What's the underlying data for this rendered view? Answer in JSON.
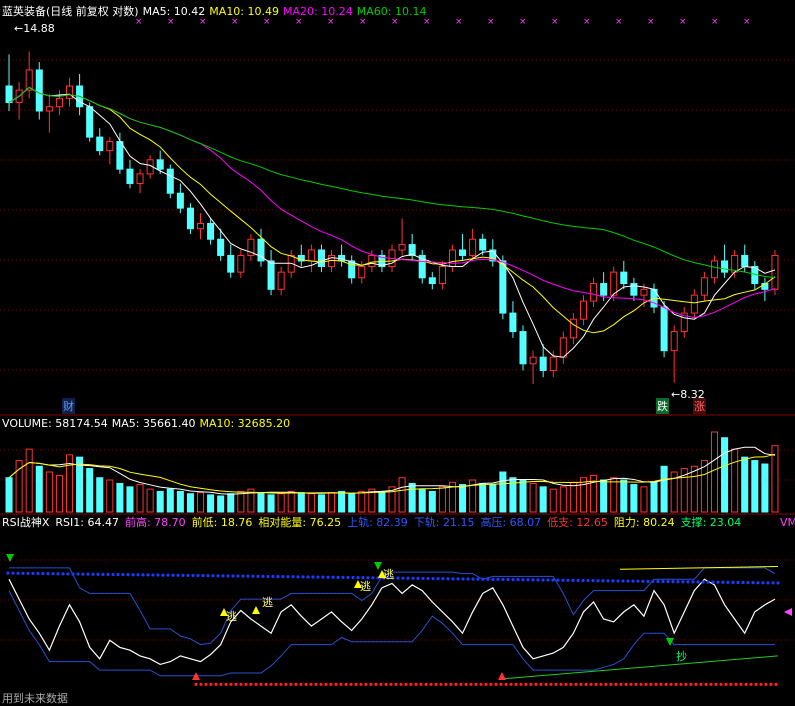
{
  "colors": {
    "bg": "#000000",
    "grid": "#6b0000",
    "up": "#ff3232",
    "down": "#54ffff",
    "ma5": "#ffffff",
    "ma10": "#ffff00",
    "ma20": "#ff00ff",
    "ma60": "#00cc00",
    "rsi": "#ffffff",
    "band": "#2a50d0",
    "blue_dots": "#1a3cff",
    "red_dots": "#ff2020",
    "yellow_line": "#ffff00",
    "green_line": "#22cc22"
  },
  "price_header": {
    "title": "蓝英装备(日线 前复权 对数)",
    "ma5": "MA5: 10.42",
    "ma10": "MA10: 10.49",
    "ma20": "MA20: 10.24",
    "ma60": "MA60: 10.14"
  },
  "price_annotations": {
    "high": "14.88",
    "low": "8.32",
    "cai": "财",
    "die": "跌",
    "zhang": "涨",
    "marks": [
      "×",
      "×",
      "×",
      "×",
      "×",
      "×",
      "×",
      "×",
      "×",
      "×",
      "×",
      "×",
      "×",
      "×",
      "×",
      "×",
      "×",
      "×",
      "×",
      "×"
    ]
  },
  "volume_header": {
    "volume": "VOLUME: 58174.54",
    "ma5": "MA5: 35661.40",
    "ma10": "MA10: 32685.20"
  },
  "rsi_header": {
    "name": "RSI战神X",
    "rsi1": "RSI1: 64.47",
    "qiangao": "前高: 78.70",
    "qiandi": "前低: 18.76",
    "xiangdui": "相对能量: 76.25",
    "shanggui": "上轨: 82.39",
    "xiagui": "下轨: 21.15",
    "gaoya": "高压: 68.07",
    "dizhi": "低支: 12.65",
    "zuli": "阻力: 80.24",
    "zhicheng": "支撑: 23.04",
    "more": "VM"
  },
  "rsi_annotations": {
    "tao": "逃",
    "chao": "抄",
    "footer": "用到未来数据"
  },
  "chart_data": {
    "type": "candlestick",
    "scale": "log",
    "ylim": [
      8.0,
      15.5
    ],
    "candles": [
      [
        14.0,
        14.8,
        13.4,
        13.6
      ],
      [
        13.6,
        14.1,
        13.2,
        13.9
      ],
      [
        13.9,
        14.88,
        13.7,
        14.4
      ],
      [
        14.4,
        14.6,
        13.2,
        13.4
      ],
      [
        13.4,
        13.8,
        12.9,
        13.5
      ],
      [
        13.5,
        13.9,
        13.3,
        13.7
      ],
      [
        13.7,
        14.2,
        13.5,
        14.0
      ],
      [
        14.0,
        14.3,
        13.3,
        13.5
      ],
      [
        13.5,
        13.6,
        12.7,
        12.8
      ],
      [
        12.8,
        13.0,
        12.4,
        12.5
      ],
      [
        12.5,
        12.8,
        12.2,
        12.7
      ],
      [
        12.7,
        12.9,
        12.0,
        12.1
      ],
      [
        12.1,
        12.3,
        11.7,
        11.8
      ],
      [
        11.8,
        12.1,
        11.6,
        12.0
      ],
      [
        12.0,
        12.4,
        11.9,
        12.3
      ],
      [
        12.3,
        12.5,
        12.0,
        12.1
      ],
      [
        12.1,
        12.2,
        11.5,
        11.6
      ],
      [
        11.6,
        11.8,
        11.2,
        11.3
      ],
      [
        11.3,
        11.4,
        10.8,
        10.9
      ],
      [
        10.9,
        11.2,
        10.7,
        11.0
      ],
      [
        11.0,
        11.1,
        10.6,
        10.7
      ],
      [
        10.7,
        10.9,
        10.3,
        10.4
      ],
      [
        10.4,
        10.6,
        10.0,
        10.1
      ],
      [
        10.1,
        10.5,
        10.0,
        10.4
      ],
      [
        10.4,
        10.8,
        10.3,
        10.7
      ],
      [
        10.7,
        10.9,
        10.2,
        10.3
      ],
      [
        10.3,
        10.5,
        9.7,
        9.8
      ],
      [
        9.8,
        10.2,
        9.7,
        10.1
      ],
      [
        10.1,
        10.5,
        10.0,
        10.4
      ],
      [
        10.4,
        10.6,
        10.2,
        10.3
      ],
      [
        10.3,
        10.6,
        10.1,
        10.5
      ],
      [
        10.5,
        10.6,
        10.1,
        10.2
      ],
      [
        10.2,
        10.5,
        10.1,
        10.4
      ],
      [
        10.4,
        10.6,
        10.2,
        10.3
      ],
      [
        10.3,
        10.4,
        9.9,
        10.0
      ],
      [
        10.0,
        10.3,
        9.9,
        10.2
      ],
      [
        10.2,
        10.5,
        10.1,
        10.4
      ],
      [
        10.4,
        10.5,
        10.1,
        10.2
      ],
      [
        10.2,
        10.6,
        10.1,
        10.5
      ],
      [
        10.5,
        11.1,
        10.4,
        10.6
      ],
      [
        10.6,
        10.8,
        10.3,
        10.4
      ],
      [
        10.4,
        10.5,
        9.9,
        10.0
      ],
      [
        10.0,
        10.1,
        9.8,
        9.9
      ],
      [
        9.9,
        10.3,
        9.8,
        10.2
      ],
      [
        10.2,
        10.6,
        10.1,
        10.5
      ],
      [
        10.5,
        10.8,
        10.3,
        10.4
      ],
      [
        10.4,
        10.9,
        10.3,
        10.7
      ],
      [
        10.7,
        10.8,
        10.4,
        10.5
      ],
      [
        10.5,
        10.7,
        10.2,
        10.3
      ],
      [
        10.3,
        10.4,
        9.3,
        9.4
      ],
      [
        9.4,
        9.6,
        9.0,
        9.1
      ],
      [
        9.1,
        9.2,
        8.5,
        8.6
      ],
      [
        8.6,
        8.8,
        8.3,
        8.7
      ],
      [
        8.7,
        8.9,
        8.4,
        8.5
      ],
      [
        8.5,
        8.8,
        8.4,
        8.7
      ],
      [
        8.7,
        9.1,
        8.6,
        9.0
      ],
      [
        9.0,
        9.4,
        8.9,
        9.3
      ],
      [
        9.3,
        9.7,
        9.2,
        9.6
      ],
      [
        9.6,
        10.0,
        9.5,
        9.9
      ],
      [
        9.9,
        10.1,
        9.6,
        9.7
      ],
      [
        9.7,
        10.2,
        9.6,
        10.1
      ],
      [
        10.1,
        10.3,
        9.8,
        9.9
      ],
      [
        9.9,
        10.0,
        9.6,
        9.7
      ],
      [
        9.7,
        9.9,
        9.5,
        9.8
      ],
      [
        9.8,
        9.9,
        9.4,
        9.5
      ],
      [
        9.5,
        9.6,
        8.7,
        8.8
      ],
      [
        8.8,
        9.2,
        8.32,
        9.1
      ],
      [
        9.1,
        9.5,
        9.0,
        9.4
      ],
      [
        9.4,
        9.8,
        9.3,
        9.7
      ],
      [
        9.7,
        10.1,
        9.6,
        10.0
      ],
      [
        10.0,
        10.4,
        9.9,
        10.3
      ],
      [
        10.3,
        10.6,
        10.0,
        10.1
      ],
      [
        10.1,
        10.5,
        10.0,
        10.4
      ],
      [
        10.4,
        10.6,
        10.1,
        10.2
      ],
      [
        10.2,
        10.3,
        9.8,
        9.9
      ],
      [
        9.9,
        10.0,
        9.6,
        9.8
      ],
      [
        9.8,
        10.5,
        9.7,
        10.4
      ]
    ],
    "volume": [
      30,
      45,
      55,
      40,
      35,
      32,
      50,
      48,
      38,
      30,
      28,
      25,
      22,
      24,
      20,
      18,
      20,
      18,
      16,
      17,
      15,
      14,
      16,
      18,
      20,
      17,
      15,
      16,
      18,
      17,
      16,
      15,
      17,
      18,
      16,
      18,
      20,
      18,
      22,
      30,
      25,
      20,
      18,
      22,
      26,
      24,
      28,
      25,
      24,
      35,
      30,
      28,
      25,
      22,
      20,
      22,
      26,
      30,
      32,
      28,
      30,
      28,
      24,
      22,
      26,
      40,
      35,
      38,
      40,
      45,
      70,
      65,
      55,
      48,
      45,
      42,
      58
    ],
    "rsi": [
      78,
      64,
      50,
      40,
      28,
      45,
      60,
      48,
      30,
      22,
      35,
      30,
      28,
      24,
      22,
      18,
      20,
      24,
      22,
      20,
      25,
      32,
      48,
      56,
      50,
      45,
      40,
      55,
      60,
      52,
      45,
      50,
      55,
      48,
      42,
      50,
      60,
      72,
      75,
      68,
      74,
      70,
      62,
      55,
      48,
      40,
      55,
      68,
      72,
      60,
      45,
      30,
      22,
      24,
      26,
      30,
      40,
      55,
      62,
      50,
      48,
      55,
      60,
      52,
      70,
      60,
      40,
      55,
      70,
      78,
      74,
      60,
      50,
      40,
      55,
      60,
      64
    ],
    "upper_band": 82.39,
    "lower_band": 21.15
  }
}
